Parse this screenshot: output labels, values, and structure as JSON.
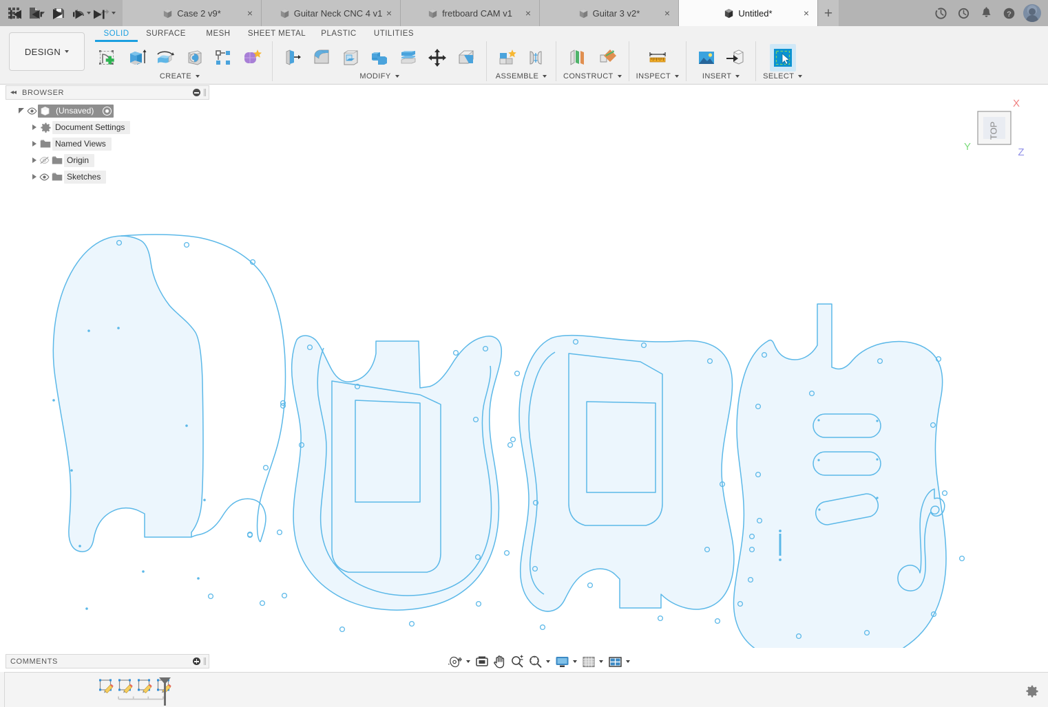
{
  "app": {
    "title": "Autodesk Fusion 360",
    "accent_blue": "#1a9fe0",
    "sketch_line_color": "#5bb8e8",
    "sketch_fill_color": "#ecf6fd",
    "canvas_bg": "#ffffff",
    "chrome_bg": "#f1f1f1",
    "tabbar_bg": "#b4b4b4"
  },
  "quick_access": {
    "items": [
      {
        "name": "app-grid",
        "icon": "grid-icon",
        "label": ""
      },
      {
        "name": "file-menu",
        "icon": "file-icon",
        "label": "",
        "has_caret": true
      },
      {
        "name": "save",
        "icon": "save-icon",
        "label": ""
      },
      {
        "name": "undo",
        "icon": "undo-icon",
        "label": "",
        "has_caret": true
      },
      {
        "name": "redo",
        "icon": "redo-icon",
        "label": "",
        "has_caret": true
      }
    ]
  },
  "tabs": [
    {
      "label": "Case 2 v9*",
      "active": false,
      "close": "×"
    },
    {
      "label": "Guitar Neck CNC 4 v1",
      "active": false,
      "close": "×"
    },
    {
      "label": "fretboard CAM v1",
      "active": false,
      "close": "×"
    },
    {
      "label": "Guitar 3 v2*",
      "active": false,
      "close": "×"
    },
    {
      "label": "Untitled*",
      "active": true,
      "close": "×"
    }
  ],
  "tab_add_label": "+",
  "top_right_icons": [
    {
      "name": "sync-icon",
      "label": ""
    },
    {
      "name": "recent-clock-icon",
      "label": ""
    },
    {
      "name": "notifications-bell-icon",
      "label": ""
    },
    {
      "name": "help-question-icon",
      "label": ""
    },
    {
      "name": "user-avatar",
      "label": ""
    }
  ],
  "ribbon": {
    "workspace_button": "DESIGN",
    "workspace_tabs": [
      {
        "label": "SOLID",
        "active": true
      },
      {
        "label": "SURFACE",
        "active": false
      },
      {
        "label": "MESH",
        "active": false
      },
      {
        "label": "SHEET METAL",
        "active": false
      },
      {
        "label": "PLASTIC",
        "active": false
      },
      {
        "label": "UTILITIES",
        "active": false
      }
    ],
    "panels": [
      {
        "label": "CREATE",
        "has_caret": true,
        "tools": [
          {
            "name": "create-sketch-icon",
            "tip": "Create Sketch"
          },
          {
            "name": "extrude-icon",
            "tip": "Extrude"
          },
          {
            "name": "revolve-icon",
            "tip": "Revolve"
          },
          {
            "name": "sweep-icon",
            "tip": "Sweep"
          },
          {
            "name": "pattern-icon",
            "tip": "Rectangular Pattern"
          },
          {
            "name": "create-form-icon",
            "tip": "Create Form"
          }
        ]
      },
      {
        "label": "MODIFY",
        "has_caret": true,
        "tools": [
          {
            "name": "press-pull-icon",
            "tip": "Press Pull"
          },
          {
            "name": "fillet-icon",
            "tip": "Fillet"
          },
          {
            "name": "shell-icon",
            "tip": "Shell"
          },
          {
            "name": "combine-icon",
            "tip": "Combine"
          },
          {
            "name": "offset-face-icon",
            "tip": "Offset Face"
          },
          {
            "name": "move-copy-icon",
            "tip": "Move/Copy"
          },
          {
            "name": "split-face-icon",
            "tip": "Split Face"
          }
        ]
      },
      {
        "label": "ASSEMBLE",
        "has_caret": true,
        "tools": [
          {
            "name": "new-component-icon",
            "tip": "New Component"
          },
          {
            "name": "joint-icon",
            "tip": "Joint"
          }
        ]
      },
      {
        "label": "CONSTRUCT",
        "has_caret": true,
        "tools": [
          {
            "name": "offset-plane-icon",
            "tip": "Offset Plane"
          },
          {
            "name": "plane-at-angle-icon",
            "tip": "Plane at Angle"
          }
        ]
      },
      {
        "label": "INSPECT",
        "has_caret": true,
        "tools": [
          {
            "name": "measure-icon",
            "tip": "Measure"
          }
        ]
      },
      {
        "label": "INSERT",
        "has_caret": true,
        "tools": [
          {
            "name": "canvas-image-icon",
            "tip": "Canvas"
          },
          {
            "name": "insert-derive-icon",
            "tip": "Insert Derive"
          }
        ]
      },
      {
        "label": "SELECT",
        "has_caret": true,
        "tools": [
          {
            "name": "select-arrow-icon",
            "tip": "Select",
            "selected": true
          }
        ]
      }
    ]
  },
  "browser": {
    "title": "BROWSER",
    "collapse_icon": "◂◂",
    "tree": [
      {
        "label": "(Unsaved)",
        "level": 0,
        "expanded": true,
        "eye": "visible",
        "icon": "component-icon",
        "selected": true,
        "radio": true
      },
      {
        "label": "Document Settings",
        "level": 1,
        "expanded": false,
        "eye": "none",
        "icon": "gear-icon"
      },
      {
        "label": "Named Views",
        "level": 1,
        "expanded": false,
        "eye": "none",
        "icon": "folder-icon"
      },
      {
        "label": "Origin",
        "level": 1,
        "expanded": false,
        "eye": "hidden",
        "icon": "folder-icon"
      },
      {
        "label": "Sketches",
        "level": 1,
        "expanded": false,
        "eye": "visible",
        "icon": "folder-icon"
      }
    ]
  },
  "comments": {
    "title": "COMMENTS"
  },
  "viewcube": {
    "face_label": "TOP",
    "axes": [
      {
        "label": "X",
        "color": "#f08080"
      },
      {
        "label": "Y",
        "color": "#7ddc7d"
      },
      {
        "label": "Z",
        "color": "#8f8fe8"
      }
    ]
  },
  "navbar": {
    "items": [
      {
        "name": "orbit-icon",
        "label": "Orbit",
        "has_caret": true
      },
      {
        "name": "look-at-icon",
        "label": "Look At",
        "has_caret": false
      },
      {
        "name": "pan-hand-icon",
        "label": "Pan",
        "has_caret": false
      },
      {
        "name": "zoom-icon",
        "label": "Zoom",
        "has_caret": false
      },
      {
        "name": "zoom-window-icon",
        "label": "Fit",
        "has_caret": true
      },
      {
        "name": "display-settings-icon",
        "label": "Display Settings",
        "has_caret": true
      },
      {
        "name": "grid-snaps-icon",
        "label": "Grid and Snaps",
        "has_caret": true
      },
      {
        "name": "viewports-icon",
        "label": "Viewports",
        "has_caret": true
      }
    ]
  },
  "timeline": {
    "playback": [
      {
        "name": "go-to-beginning-button",
        "glyph": "start"
      },
      {
        "name": "step-back-button",
        "glyph": "prev"
      },
      {
        "name": "play-button",
        "glyph": "play"
      },
      {
        "name": "step-forward-button",
        "glyph": "next"
      },
      {
        "name": "go-to-end-button",
        "glyph": "end"
      }
    ],
    "features": [
      {
        "name": "timeline-sketch-1",
        "type": "sketch"
      },
      {
        "name": "timeline-sketch-2",
        "type": "sketch"
      },
      {
        "name": "timeline-sketch-3",
        "type": "sketch"
      },
      {
        "name": "timeline-sketch-4",
        "type": "sketch"
      }
    ],
    "end_marker": "timeline-end-marker"
  },
  "status_bar": {
    "settings_icon": "gear-icon"
  },
  "sketch_geometry": {
    "description": "Four overlaid guitar body / pickguard sketch outlines in TOP view, drawn as light-blue closed profiles with small construction circles at mounting screw locations.",
    "shapes": [
      {
        "name": "pickguard-outline-left",
        "holes": 14
      },
      {
        "name": "guitar-body-with-pickguard",
        "holes": 18
      },
      {
        "name": "guitar-body-control-cavity",
        "holes": 18
      },
      {
        "name": "guitar-body-pickup-routes",
        "holes": 16,
        "features": [
          "3 single-coil pickup slots",
          "f-hole",
          "string-through slot"
        ]
      }
    ]
  }
}
